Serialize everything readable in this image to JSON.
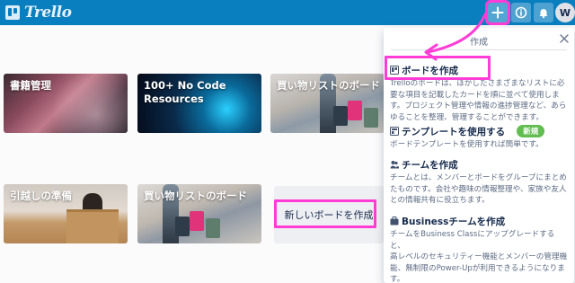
{
  "app": {
    "logo_text": "Trello",
    "avatar_initial": "W"
  },
  "topbar": {
    "create_button": {
      "icon": "plus-icon"
    },
    "info_button": {
      "icon": "info-icon"
    },
    "notifications_button": {
      "icon": "bell-icon"
    }
  },
  "boards": [
    {
      "title": "書籍管理"
    },
    {
      "title": "100+ No Code\nResources"
    },
    {
      "title": "買い物リストのボード"
    },
    {
      "title": "引越しの準備"
    },
    {
      "title": "買い物リストのボード"
    }
  ],
  "create_board_tile": {
    "label": "新しいボードを作成"
  },
  "popover": {
    "title": "作成",
    "items": [
      {
        "label": "ボードを作成",
        "icon": "board-icon",
        "description": "Trelloのボードは、ほかしたさまざまなリストに必\n要な項目を記載したカードを順に並べて使用しま\nす。プロジェクト管理や情報の進捗管理など、あら\nゆることを整理、管理することができます。"
      },
      {
        "label": "テンプレートを使用する",
        "icon": "template-icon",
        "badge": "新規",
        "description": "ボードテンプレートを使用すれば簡単です。"
      },
      {
        "label": "チームを作成",
        "icon": "team-icon",
        "description": "チームとは、メンバーとボードをグループにまとめ\nたものです。会社や趣味の情報整理や、家族や友人\nとの情報共有に役立ちます。"
      },
      {
        "label": "Businessチームを作成",
        "icon": "business-icon",
        "description": "チームをBusiness Classにアップグレードすると、\n高レベルのセキュリティー機能とメンバーの管理機\n能、無制限のPower-Upが利用できるようになりま\nす。"
      }
    ]
  },
  "colors": {
    "topbar": "#0a7fc0",
    "highlight": "#ff3dd6",
    "badge": "#61bd4f"
  }
}
